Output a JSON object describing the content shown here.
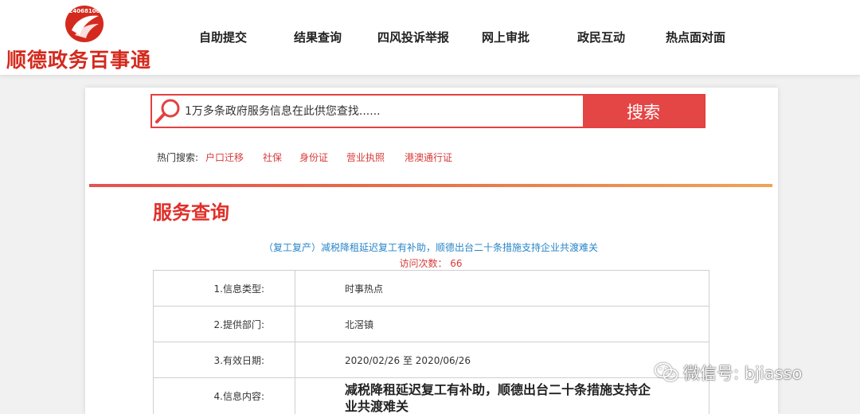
{
  "header": {
    "logo_emblem_text": "24068100",
    "logo_text": "顺德政务百事通",
    "nav": [
      {
        "label": "自助提交"
      },
      {
        "label": "结果查询"
      },
      {
        "label": "四风投诉举报"
      },
      {
        "label": "网上审批"
      },
      {
        "label": "政民互动"
      },
      {
        "label": "热点面对面"
      }
    ]
  },
  "search": {
    "placeholder": "1万多条政府服务信息在此供您查找......",
    "button_label": "搜索",
    "icon": "magnifier-icon"
  },
  "hot": {
    "label": "热门搜索:",
    "items": [
      "户口迁移",
      "社保",
      "身份证",
      "营业执照",
      "港澳通行证"
    ]
  },
  "service": {
    "title": "服务查询",
    "article_title": "（复工复产）减税降租延迟复工有补助，顺德出台二十条措施支持企业共渡难关",
    "visit_label": "访问次数：",
    "visit_count": "66"
  },
  "table": {
    "rows": [
      {
        "label": "1.信息类型:",
        "value": "时事热点"
      },
      {
        "label": "2.提供部门:",
        "value": "北滘镇"
      },
      {
        "label": "3.有效日期:",
        "value": "2020/02/26 至 2020/06/26"
      },
      {
        "label": "4.信息内容:",
        "value": "减税降租延迟复工有补助，顺德出台二十条措施支持企业共渡难关"
      }
    ]
  },
  "watermark": {
    "text": "微信号: bjiasso",
    "icon": "wechat-icon"
  },
  "colors": {
    "brand_red": "#d42a1e",
    "search_red": "#e44545",
    "link_red": "#d83a3a",
    "title_blue": "#2a86c8"
  }
}
